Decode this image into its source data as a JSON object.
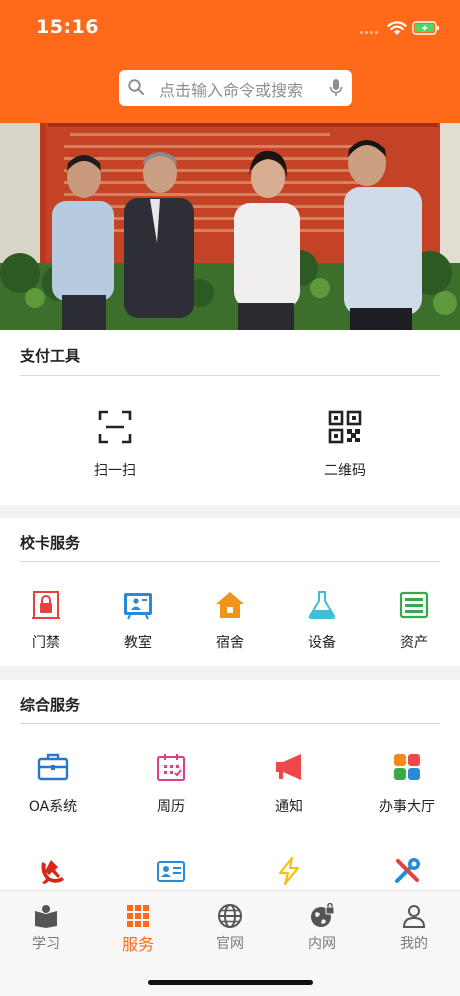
{
  "status_bar": {
    "time": "15:16"
  },
  "search": {
    "placeholder": "点击输入命令或搜索"
  },
  "pay_tools": {
    "title": "支付工具",
    "items": [
      {
        "label": "扫一扫",
        "icon": "scan-icon"
      },
      {
        "label": "二维码",
        "icon": "qrcode-icon"
      }
    ]
  },
  "campus_card": {
    "title": "校卡服务",
    "items": [
      {
        "label": "门禁",
        "icon": "lock-icon",
        "color": "#e8403a"
      },
      {
        "label": "教室",
        "icon": "classroom-icon",
        "color": "#2a8ad8"
      },
      {
        "label": "宿舍",
        "icon": "dorm-house-icon",
        "color": "#f0951a"
      },
      {
        "label": "设备",
        "icon": "flask-icon",
        "color": "#3dbfd9"
      },
      {
        "label": "资产",
        "icon": "asset-list-icon",
        "color": "#3aa84a"
      }
    ]
  },
  "general": {
    "title": "综合服务",
    "items": [
      {
        "label": "OA系统",
        "icon": "briefcase-icon",
        "color": "#2a77c8"
      },
      {
        "label": "周历",
        "icon": "calendar-icon",
        "color": "#e23c8c"
      },
      {
        "label": "通知",
        "icon": "megaphone-icon",
        "color": "#f04848"
      },
      {
        "label": "办事大厅",
        "icon": "grid-apps-icon",
        "color": "#f08a1a"
      }
    ],
    "row2_icons": [
      "party-emblem-icon",
      "id-card-icon",
      "lightning-icon",
      "tools-icon"
    ]
  },
  "tabbar": {
    "items": [
      {
        "label": "学习",
        "icon": "study-icon"
      },
      {
        "label": "服务",
        "icon": "service-grid-icon",
        "active": true
      },
      {
        "label": "官网",
        "icon": "globe-icon"
      },
      {
        "label": "内网",
        "icon": "intranet-icon"
      },
      {
        "label": "我的",
        "icon": "person-icon"
      }
    ]
  },
  "colors": {
    "accent": "#ff6a1a",
    "background": "#f2f2f2"
  }
}
